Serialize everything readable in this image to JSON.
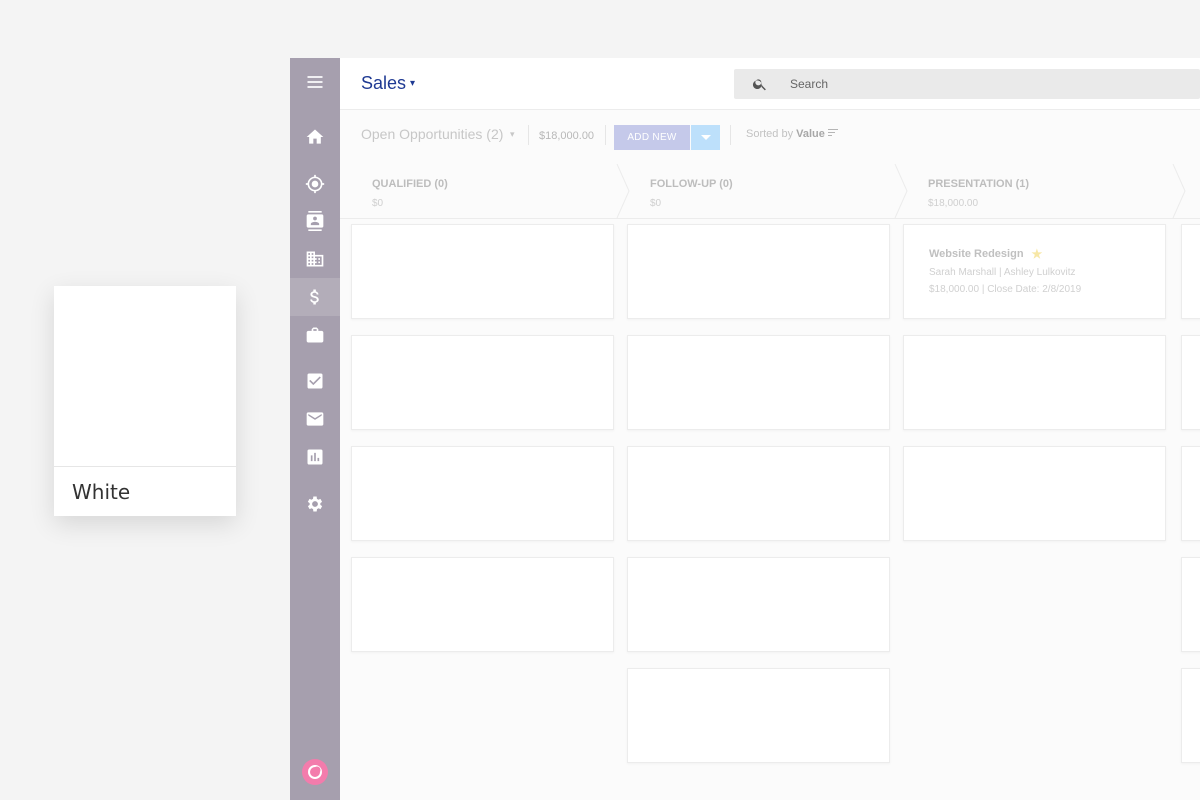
{
  "swatch": {
    "label": "White",
    "color": "#ffffff"
  },
  "sidebar": {
    "background": "#a69fae",
    "items": [
      {
        "icon": "menu-icon"
      },
      {
        "icon": "home-icon"
      },
      {
        "icon": "target-icon"
      },
      {
        "icon": "contacts-icon"
      },
      {
        "icon": "company-icon"
      },
      {
        "icon": "dollar-icon",
        "active": true
      },
      {
        "icon": "briefcase-icon"
      },
      {
        "icon": "task-check-icon"
      },
      {
        "icon": "mail-icon"
      },
      {
        "icon": "chart-icon"
      },
      {
        "icon": "gear-icon"
      }
    ],
    "logo": "app-logo-icon"
  },
  "header": {
    "title": "Sales",
    "title_color": "#1f3a93",
    "search": {
      "placeholder": "Search"
    }
  },
  "toolbar": {
    "filter_label": "Open Opportunities (2)",
    "total": "$18,000.00",
    "add_new_label": "ADD NEW",
    "sorted_prefix": "Sorted by",
    "sorted_value": "Value"
  },
  "stages": [
    {
      "name": "QUALIFIED (0)",
      "amount": "$0"
    },
    {
      "name": "FOLLOW-UP (0)",
      "amount": "$0"
    },
    {
      "name": "PRESENTATION (1)",
      "amount": "$18,000.00"
    }
  ],
  "cards": [
    {
      "title": "Website Redesign",
      "starred": true,
      "people": "Sarah Marshall | Ashley Lulkovitz",
      "info": "$18,000.00 | Close Date: 2/8/2019"
    }
  ]
}
